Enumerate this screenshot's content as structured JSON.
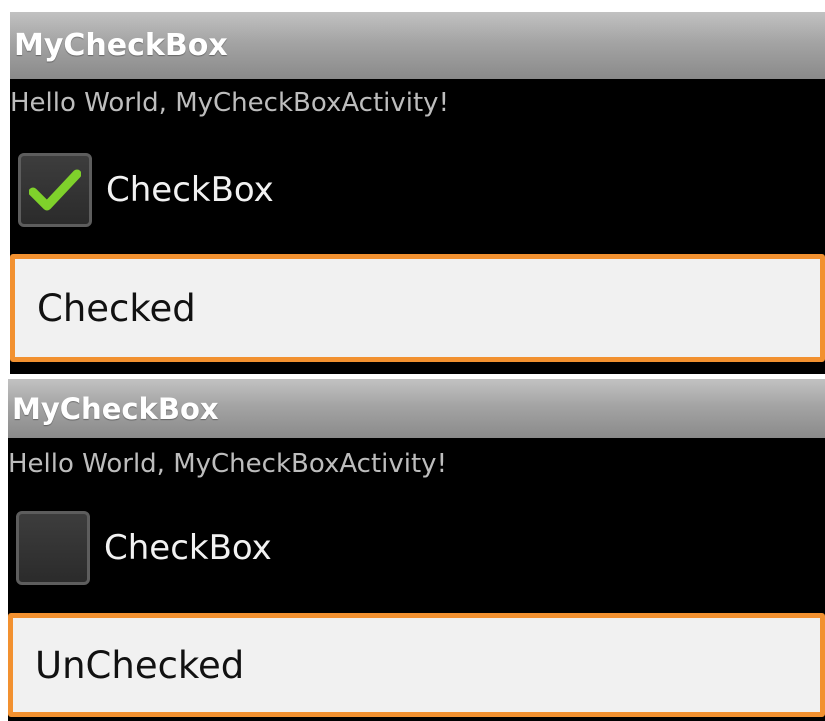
{
  "screens": [
    {
      "title": "MyCheckBox",
      "hello_text": "Hello World, MyCheckBoxActivity!",
      "checkbox": {
        "label": "CheckBox",
        "checked": true
      },
      "textfield": {
        "value": "Checked"
      }
    },
    {
      "title": "MyCheckBox",
      "hello_text": "Hello World, MyCheckBoxActivity!",
      "checkbox": {
        "label": "CheckBox",
        "checked": false
      },
      "textfield": {
        "value": "UnChecked"
      }
    }
  ],
  "colors": {
    "background": "#000000",
    "titlebar": "#a4a4a4",
    "focus_border": "#f29130",
    "checkmark": "#7fd12b"
  },
  "icons": {
    "check": "check-icon"
  }
}
